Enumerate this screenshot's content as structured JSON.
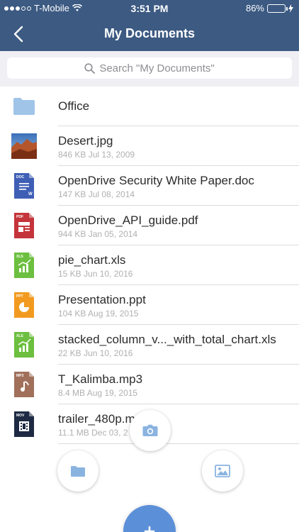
{
  "status_bar": {
    "carrier": "T-Mobile",
    "time": "3:51 PM",
    "battery": "86%",
    "battery_level": 0.86
  },
  "nav": {
    "title": "My Documents",
    "back_icon": "chevron-left-icon"
  },
  "search": {
    "placeholder": "Search \"My Documents\""
  },
  "files": [
    {
      "name": "Office",
      "meta": "",
      "type": "folder",
      "icon": "folder-icon"
    },
    {
      "name": "Desert.jpg",
      "meta": "846 KB Jul 13, 2009",
      "type": "jpg",
      "icon": "photo-thumbnail-icon"
    },
    {
      "name": "OpenDrive Security White Paper.doc",
      "meta": "147 KB Jul 08, 2014",
      "type": "doc",
      "icon": "doc-file-icon",
      "badge": "DOC",
      "color": "#3f5fb5"
    },
    {
      "name": "OpenDrive_API_guide.pdf",
      "meta": "944 KB Jan 05, 2014",
      "type": "pdf",
      "icon": "pdf-file-icon",
      "badge": "PDF",
      "color": "#c4343a"
    },
    {
      "name": "pie_chart.xls",
      "meta": "15 KB Jun 10, 2016",
      "type": "xls",
      "icon": "xls-file-icon",
      "badge": "XLS",
      "color": "#6cbf3f"
    },
    {
      "name": "Presentation.ppt",
      "meta": "104 KB Aug 19, 2015",
      "type": "ppt",
      "icon": "ppt-file-icon",
      "badge": "PPT",
      "color": "#f29a1f"
    },
    {
      "name": "stacked_column_v..._with_total_chart.xls",
      "meta": "22 KB Jun 10, 2016",
      "type": "xls",
      "icon": "xls-file-icon",
      "badge": "XLS",
      "color": "#6cbf3f"
    },
    {
      "name": "T_Kalimba.mp3",
      "meta": "8.4 MB Aug 19, 2015",
      "type": "mp3",
      "icon": "mp3-file-icon",
      "badge": "MP3",
      "color": "#a0705a"
    },
    {
      "name": "trailer_480p.m",
      "meta": "11.1 MB Dec 03, 2",
      "type": "mov",
      "icon": "mov-file-icon",
      "badge": "MOV",
      "color": "#1e2a44"
    }
  ],
  "actions": {
    "camera": "camera-icon",
    "folder": "folder-icon",
    "image": "image-icon",
    "add": "plus-icon"
  },
  "colors": {
    "header": "#3c5a82",
    "accent": "#5b8fd8",
    "folder": "#9fc4e8"
  }
}
